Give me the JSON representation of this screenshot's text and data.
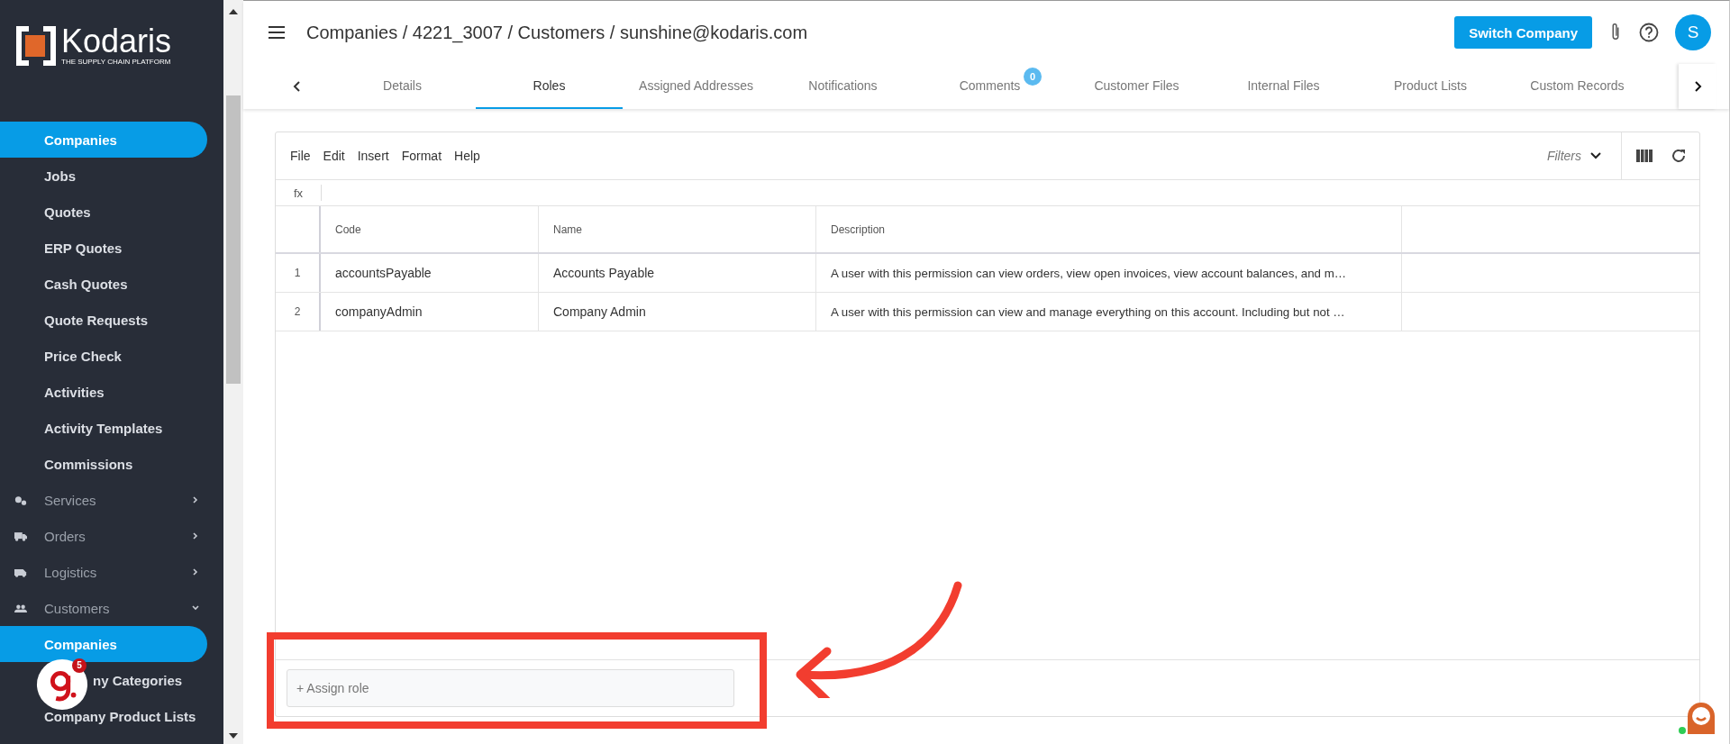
{
  "sidebar": {
    "logo": {
      "name": "Kodaris",
      "tagline": "THE SUPPLY CHAIN PLATFORM"
    },
    "items": [
      {
        "label": "Companies",
        "kind": "sub",
        "selected": true
      },
      {
        "label": "Jobs",
        "kind": "sub",
        "selected": false
      },
      {
        "label": "Quotes",
        "kind": "sub",
        "selected": false
      },
      {
        "label": "ERP Quotes",
        "kind": "sub",
        "selected": false
      },
      {
        "label": "Cash Quotes",
        "kind": "sub",
        "selected": false
      },
      {
        "label": "Quote Requests",
        "kind": "sub",
        "selected": false
      },
      {
        "label": "Price Check",
        "kind": "sub",
        "selected": false
      },
      {
        "label": "Activities",
        "kind": "sub",
        "selected": false
      },
      {
        "label": "Activity Templates",
        "kind": "sub",
        "selected": false
      },
      {
        "label": "Commissions",
        "kind": "sub",
        "selected": false
      },
      {
        "label": "Services",
        "kind": "section",
        "expanded": false,
        "selected": false
      },
      {
        "label": "Orders",
        "kind": "section",
        "expanded": false,
        "selected": false
      },
      {
        "label": "Logistics",
        "kind": "section",
        "expanded": false,
        "selected": false
      },
      {
        "label": "Customers",
        "kind": "section",
        "expanded": true,
        "selected": false
      },
      {
        "label": "Companies",
        "kind": "sub",
        "selected": true
      },
      {
        "label": "ny Categories",
        "kind": "sub",
        "selected": false
      },
      {
        "label": "Company Product Lists",
        "kind": "sub",
        "selected": false
      }
    ],
    "helper_badge": {
      "count": "5"
    }
  },
  "header": {
    "breadcrumb": "Companies / 4221_3007 / Customers / sunshine@kodaris.com",
    "switch_button": "Switch Company",
    "avatar": "S"
  },
  "tabs": [
    {
      "label": "Details",
      "selected": false
    },
    {
      "label": "Roles",
      "selected": true
    },
    {
      "label": "Assigned Addresses",
      "selected": false
    },
    {
      "label": "Notifications",
      "selected": false
    },
    {
      "label": "Comments",
      "selected": false,
      "badge": "0"
    },
    {
      "label": "Customer Files",
      "selected": false
    },
    {
      "label": "Internal Files",
      "selected": false
    },
    {
      "label": "Product Lists",
      "selected": false
    },
    {
      "label": "Custom Records",
      "selected": false
    }
  ],
  "grid": {
    "menu": [
      "File",
      "Edit",
      "Insert",
      "Format",
      "Help"
    ],
    "filters": "Filters",
    "formula_label": "fx",
    "columns": [
      "Code",
      "Name",
      "Description"
    ],
    "rows": [
      {
        "index": "1",
        "cells": [
          "accountsPayable",
          "Accounts Payable",
          "A user with this permission can view orders, view open invoices, view account balances, and m…"
        ]
      },
      {
        "index": "2",
        "cells": [
          "companyAdmin",
          "Company Admin",
          "A user with this permission can view and manage everything on this account. Including but not …"
        ]
      }
    ],
    "assign_placeholder": "+ Assign role"
  }
}
